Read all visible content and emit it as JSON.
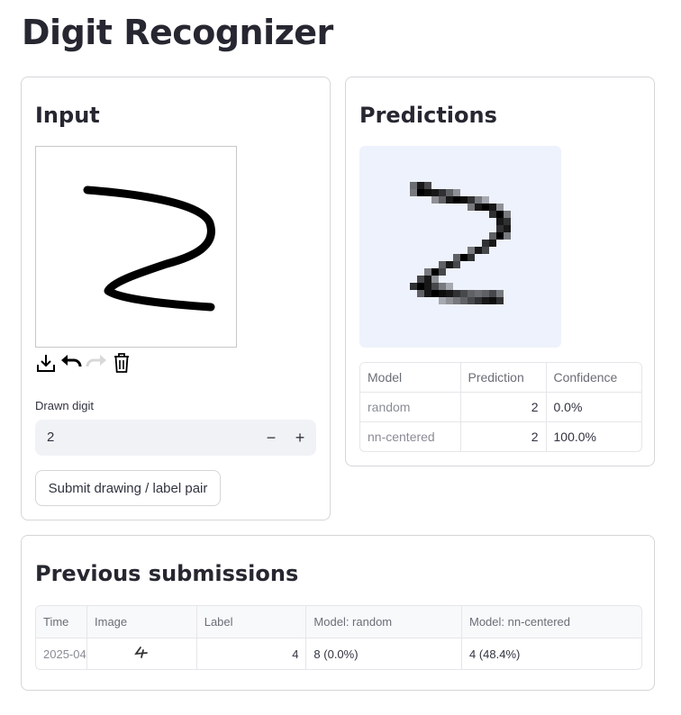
{
  "app": {
    "title": "Digit Recognizer"
  },
  "input_panel": {
    "title": "Input",
    "toolbar": {
      "download_icon": "download-icon",
      "undo_icon": "undo-icon",
      "redo_icon": "redo-icon",
      "delete_icon": "trash-icon"
    },
    "digit_label": "Drawn digit",
    "digit_value": "2",
    "decrement_label": "−",
    "increment_label": "+",
    "submit_label": "Submit drawing / label pair"
  },
  "predictions_panel": {
    "title": "Predictions",
    "columns": [
      "Model",
      "Prediction",
      "Confidence"
    ],
    "rows": [
      {
        "model": "random",
        "prediction": "2",
        "confidence": "0.0%"
      },
      {
        "model": "nn-centered",
        "prediction": "2",
        "confidence": "100.0%"
      }
    ]
  },
  "submissions_panel": {
    "title": "Previous submissions",
    "columns": [
      "Time",
      "Image",
      "Label",
      "Model: random",
      "Model: nn-centered"
    ],
    "rows": [
      {
        "time": "2025-04",
        "label": "4",
        "model_random": "8 (0.0%)",
        "model_nn": "4 (48.4%)"
      }
    ]
  },
  "colors": {
    "accent_bg": "#eef2fc",
    "input_bg": "#f0f2f6",
    "border": "#d6d6d9"
  }
}
